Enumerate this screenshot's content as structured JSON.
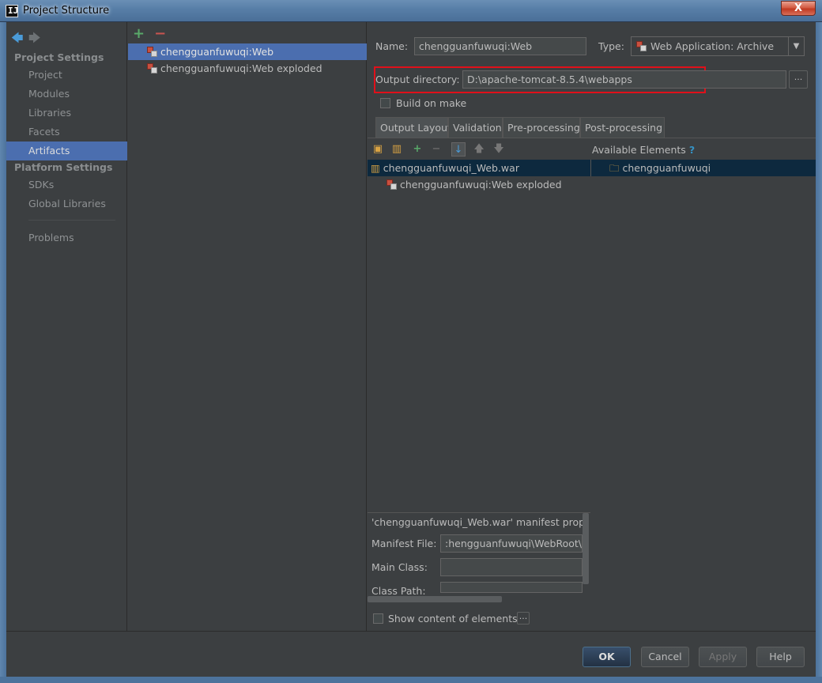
{
  "window": {
    "title": "Project Structure",
    "close_glyph": "X"
  },
  "nav": {
    "back_glyph": "🡄",
    "forward_glyph": "🡆"
  },
  "sidebar": {
    "project_settings_header": "Project Settings",
    "platform_settings_header": "Platform Settings",
    "items": [
      {
        "label": "Project"
      },
      {
        "label": "Modules"
      },
      {
        "label": "Libraries"
      },
      {
        "label": "Facets"
      },
      {
        "label": "Artifacts",
        "selected": true
      },
      {
        "label": "SDKs"
      },
      {
        "label": "Global Libraries"
      },
      {
        "label": "Problems"
      }
    ]
  },
  "artifacts": {
    "add_glyph": "+",
    "remove_glyph": "−",
    "items": [
      {
        "label": "chengguanfuwuqi:Web",
        "selected": true
      },
      {
        "label": "chengguanfuwuqi:Web exploded"
      }
    ]
  },
  "form": {
    "name_label": "Name:",
    "name_value": "chengguanfuwuqi:Web",
    "type_label": "Type:",
    "type_value": "Web Application: Archive",
    "output_label": "Output directory:",
    "output_value": "D:\\apache-tomcat-8.5.4\\webapps",
    "browse_glyph": "...",
    "build_on_make_label": "Build on make"
  },
  "tabs": [
    {
      "label": "Output Layout",
      "active": true
    },
    {
      "label": "Validation"
    },
    {
      "label": "Pre-processing"
    },
    {
      "label": "Post-processing"
    }
  ],
  "layout": {
    "available_elements_label": "Available Elements",
    "help_glyph": "?",
    "root_item": "chengguanfuwuqi_Web.war",
    "child_item": "chengguanfuwuqi:Web exploded",
    "available_item": "chengguanfuwuqi"
  },
  "manifest": {
    "header": "'chengguanfuwuqi_Web.war' manifest propert",
    "manifest_file_label": "Manifest File:",
    "manifest_file_value": ":hengguanfuwuqi\\WebRoot\\M",
    "main_class_label": "Main Class:",
    "main_class_value": "",
    "class_path_label": "Class Path:",
    "class_path_value": "",
    "show_content_label": "Show content of elements",
    "show_content_glyph": "..."
  },
  "buttons": {
    "ok": "OK",
    "cancel": "Cancel",
    "apply": "Apply",
    "help": "Help"
  },
  "colors": {
    "selection": "#4b6eaf",
    "tree_selection": "#0d293e",
    "highlight_box": "#e0101a",
    "background": "#3c3f41"
  }
}
